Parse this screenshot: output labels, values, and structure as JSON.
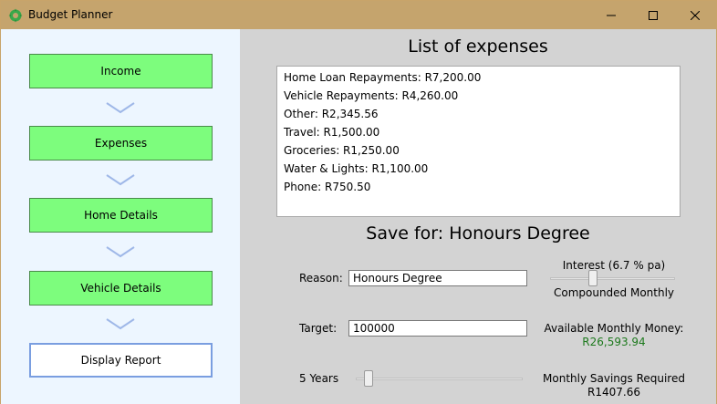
{
  "window": {
    "title": "Budget Planner",
    "app_icon": "leaf-gear-icon",
    "controls": {
      "minimize": "minimize-icon",
      "maximize": "maximize-icon",
      "close": "close-icon"
    }
  },
  "nav": {
    "buttons": [
      {
        "label": "Income"
      },
      {
        "label": "Expenses"
      },
      {
        "label": "Home Details"
      },
      {
        "label": "Vehicle Details"
      },
      {
        "label": "Display Report"
      }
    ]
  },
  "expenses": {
    "heading": "List of expenses",
    "items": [
      "Home Loan Repayments: R7,200.00",
      "Vehicle Repayments: R4,260.00",
      "Other: R2,345.56",
      "Travel: R1,500.00",
      "Groceries: R1,250.00",
      "Water & Lights: R1,100.00",
      "Phone: R750.50"
    ]
  },
  "savings": {
    "heading": "Save for: Honours Degree",
    "reason_label": "Reason:",
    "reason_value": "Honours Degree",
    "target_label": "Target:",
    "target_value": "100000",
    "years_label": "5 Years",
    "years_slider_value": 0.05,
    "interest_label": "Interest (6.7 % pa)",
    "interest_slider_value": 0.33,
    "compound_label": "Compounded Monthly",
    "available_label": "Available Monthly Money:",
    "available_value": "R26,593.94",
    "required_label": "Monthly Savings Required",
    "required_value": "R1407.66"
  },
  "colors": {
    "titlebar": "#c5a46d",
    "nav_bg": "#edf6ff",
    "nav_button": "#7dfd7d",
    "content_bg": "#d3d3d3",
    "available_value": "#1e7a1e"
  }
}
